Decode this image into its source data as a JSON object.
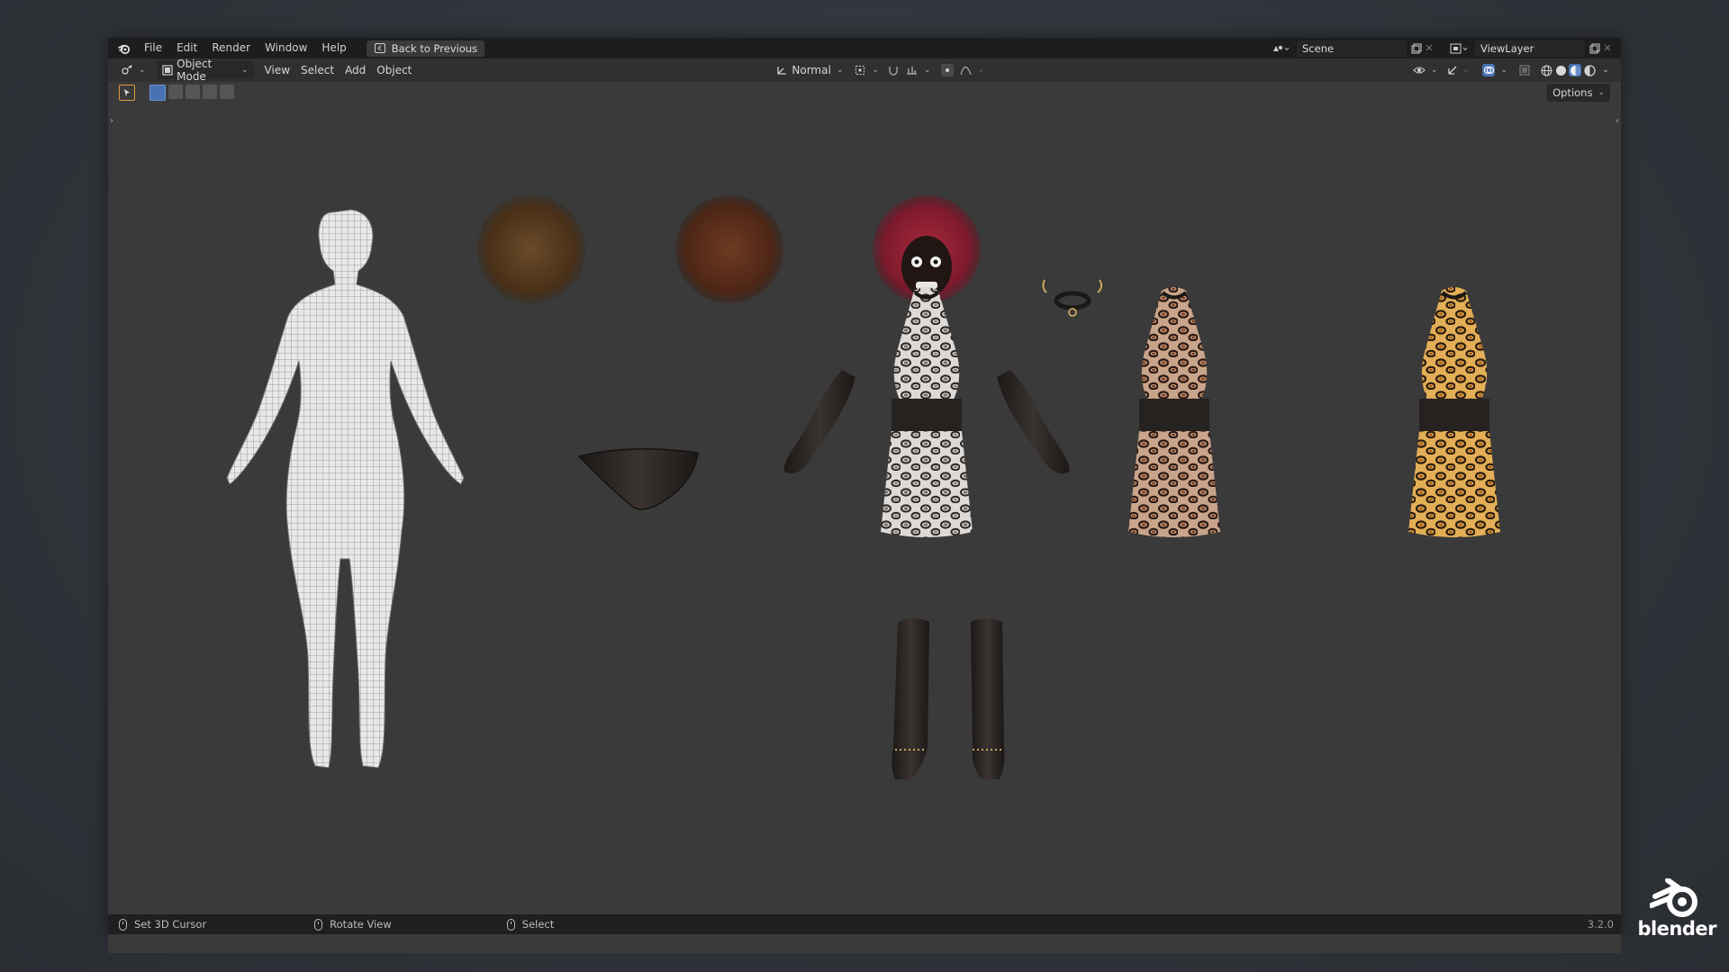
{
  "menu": {
    "items": [
      "File",
      "Edit",
      "Render",
      "Window",
      "Help"
    ],
    "back_button": "Back to Previous",
    "scene_name": "Scene",
    "view_layer": "ViewLayer"
  },
  "header": {
    "mode": "Object Mode",
    "menus": [
      "View",
      "Select",
      "Add",
      "Object"
    ],
    "orientation": "Normal",
    "options_label": "Options"
  },
  "status": {
    "left_click": "Set 3D Cursor",
    "middle_click": "Rotate View",
    "right_click": "Select",
    "version": "3.2.0"
  },
  "brand": {
    "wordmark": "blender"
  },
  "colors": {
    "accent_blue": "#4772b3",
    "viewport_bg": "#3a3a3a",
    "header_bg": "#303030",
    "topbar_bg": "#1d1d1d"
  },
  "icons": [
    "blender-logo-icon",
    "editor-type-icon",
    "object-mode-icon",
    "orientation-icon",
    "pivot-icon",
    "snap-icon",
    "proportional-icon",
    "visibility-icon",
    "gizmo-icon",
    "overlay-icon",
    "xray-icon",
    "shading-wire-icon",
    "shading-solid-icon",
    "shading-material-icon",
    "shading-rendered-icon"
  ]
}
